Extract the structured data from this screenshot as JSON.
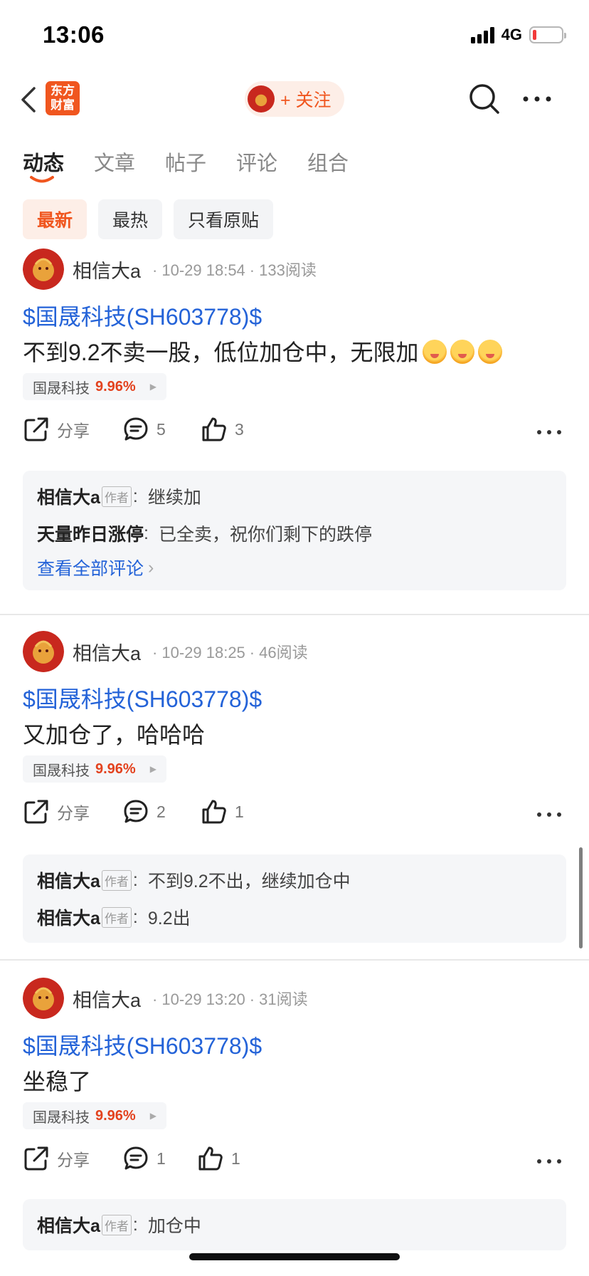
{
  "status_bar": {
    "time": "13:06",
    "network": "4G",
    "battery_level": 0.12
  },
  "nav": {
    "brand_line1": "东方",
    "brand_line2": "财富",
    "follow_label": "+ 关注"
  },
  "tabs": [
    "动态",
    "文章",
    "帖子",
    "评论",
    "组合"
  ],
  "active_tab": "动态",
  "filters": [
    "最新",
    "最热",
    "只看原贴"
  ],
  "active_filter": "最新",
  "posts": [
    {
      "username": "相信大a",
      "time": "10-29 18:54",
      "reads": "133阅读",
      "stock_link": "$国晟科技(SH603778)$",
      "content": "不到9.2不卖一股，低位加仓中，无限加",
      "emoji_count": 3,
      "stock_name": "国晟科技",
      "stock_pct": "9.96%",
      "share_label": "分享",
      "comment_count": "5",
      "like_count": "3",
      "comments": [
        {
          "name": "相信大a",
          "is_author": true,
          "text": "继续加"
        },
        {
          "name": "天量昨日涨停",
          "is_author": false,
          "text": "已全卖，祝你们剩下的跌停"
        }
      ],
      "view_all": "查看全部评论"
    },
    {
      "username": "相信大a",
      "time": "10-29 18:25",
      "reads": "46阅读",
      "stock_link": "$国晟科技(SH603778)$",
      "content": "又加仓了，哈哈哈",
      "stock_name": "国晟科技",
      "stock_pct": "9.96%",
      "share_label": "分享",
      "comment_count": "2",
      "like_count": "1",
      "comments": [
        {
          "name": "相信大a",
          "is_author": true,
          "text": "不到9.2不出，继续加仓中"
        },
        {
          "name": "相信大a",
          "is_author": true,
          "text": "9.2出"
        }
      ]
    },
    {
      "username": "相信大a",
      "time": "10-29 13:20",
      "reads": "31阅读",
      "stock_link": "$国晟科技(SH603778)$",
      "content": "坐稳了",
      "stock_name": "国晟科技",
      "stock_pct": "9.96%",
      "share_label": "分享",
      "comment_count": "1",
      "like_count": "1",
      "comments": [
        {
          "name": "相信大a",
          "is_author": true,
          "text": "加仓中"
        }
      ]
    }
  ],
  "author_badge": "作者",
  "colors": {
    "accent": "#f0561f",
    "link": "#2463d8",
    "rise": "#e3421e"
  }
}
